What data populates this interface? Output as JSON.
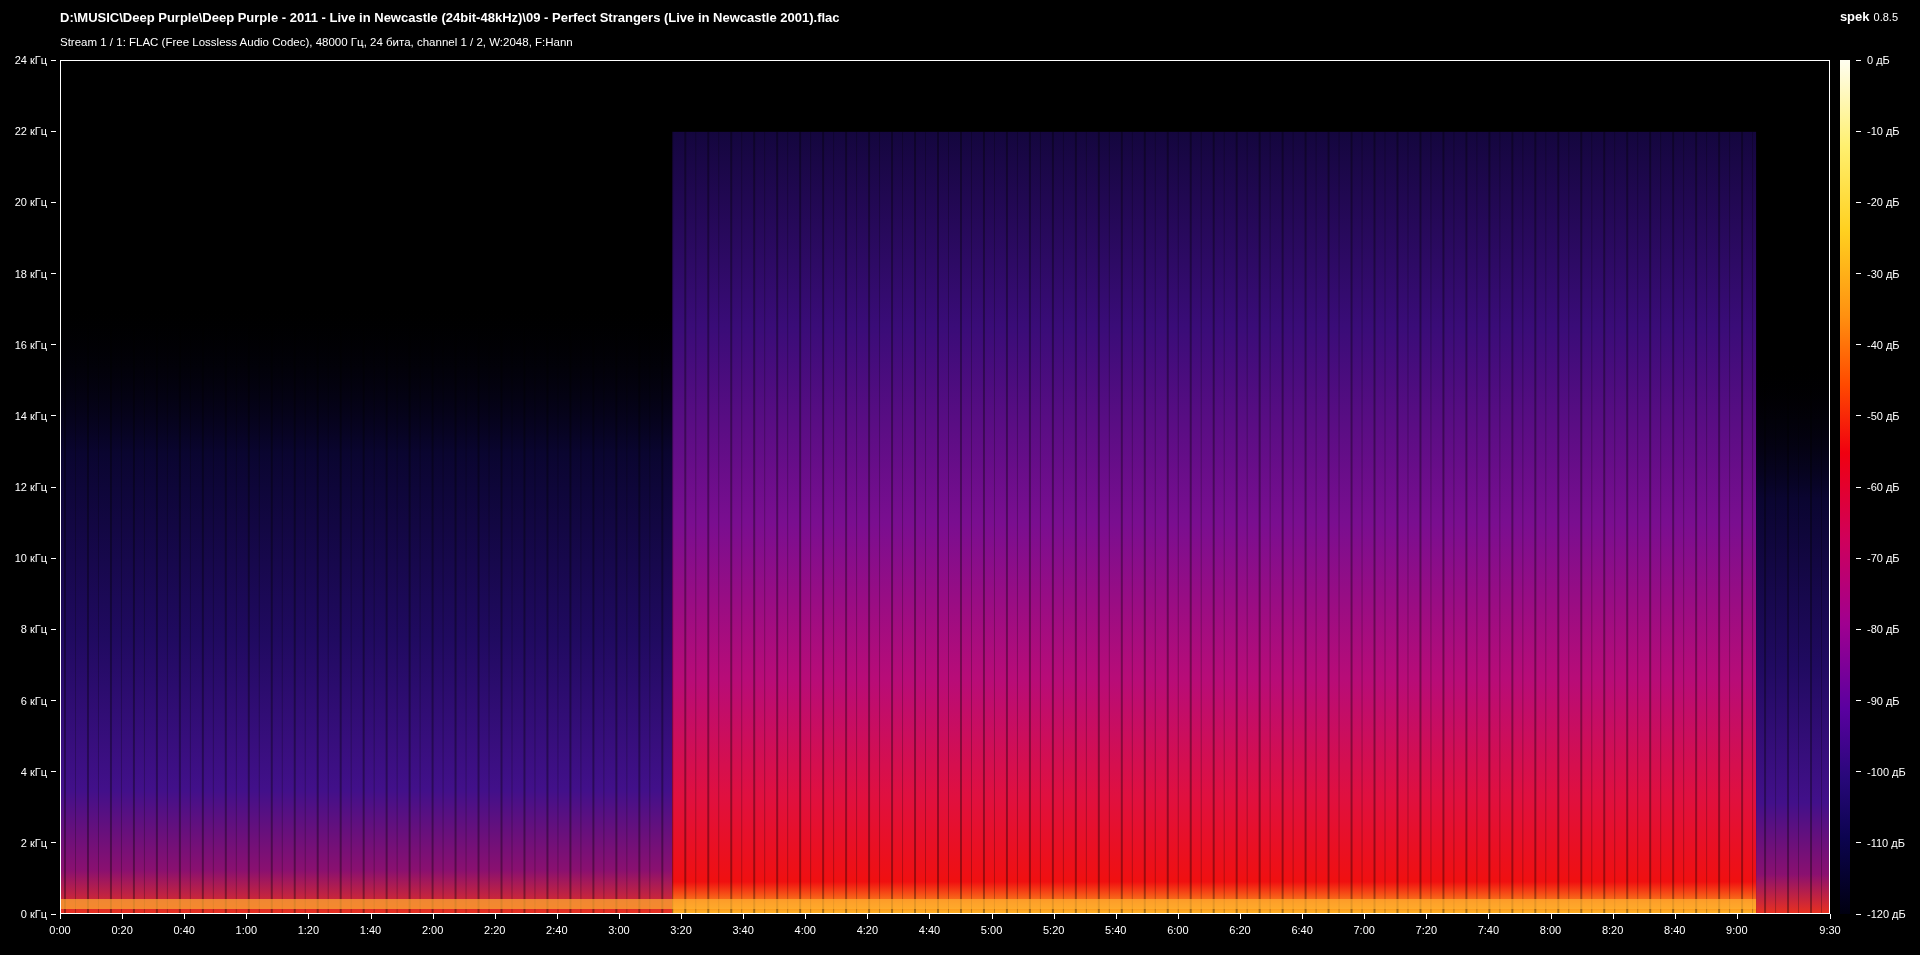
{
  "window": {
    "title": "D:\\MUSIC\\Deep Purple\\Deep Purple - 2011 - Live in Newcastle (24bit-48kHz)\\09 - Perfect Strangers (Live in Newcastle 2001).flac",
    "stream_info": "Stream 1 / 1: FLAC (Free Lossless Audio Codec), 48000 Гц, 24 бита, channel 1 / 2, W:2048, F:Hann"
  },
  "app": {
    "name": "spek",
    "version": "0.8.5"
  },
  "frequency_axis": {
    "labels": [
      "24 кГц",
      "22 кГц",
      "20 кГц",
      "18 кГц",
      "16 кГц",
      "14 кГц",
      "12 кГц",
      "10 кГц",
      "8 кГц",
      "6 кГц",
      "4 кГц",
      "2 кГц",
      "0 кГц"
    ]
  },
  "time_axis": {
    "labels": [
      "0:00",
      "0:20",
      "0:40",
      "1:00",
      "1:20",
      "1:40",
      "2:00",
      "2:20",
      "2:40",
      "3:00",
      "3:20",
      "3:40",
      "4:00",
      "4:20",
      "4:40",
      "5:00",
      "5:20",
      "5:40",
      "6:00",
      "6:20",
      "6:40",
      "7:00",
      "7:20",
      "7:40",
      "8:00",
      "8:20",
      "8:40",
      "9:00",
      "9:30"
    ]
  },
  "decibel_scale": {
    "labels": [
      "0 дБ",
      "-10 дБ",
      "-20 дБ",
      "-30 дБ",
      "-40 дБ",
      "-50 дБ",
      "-60 дБ",
      "-70 дБ",
      "-80 дБ",
      "-90 дБ",
      "-100 дБ",
      "-110 дБ",
      "-120 дБ"
    ]
  }
}
